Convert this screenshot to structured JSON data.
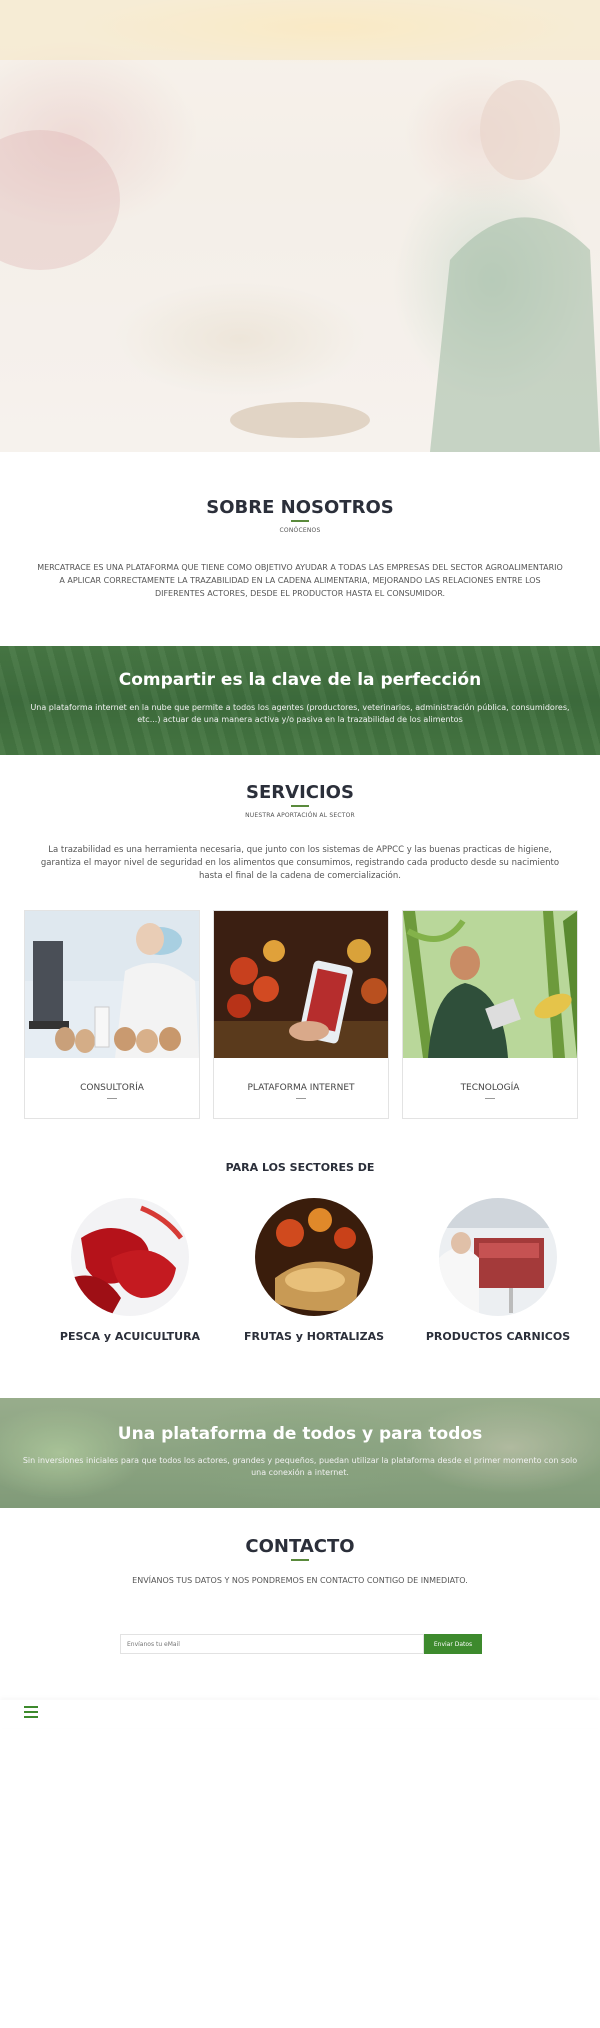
{
  "about": {
    "title": "SOBRE NOSOTROS",
    "subtitle": "CONÓCENOS",
    "text": "MERCATRACE ES UNA PLATAFORMA QUE TIENE COMO OBJETIVO AYUDAR A TODAS LAS EMPRESAS DEL SECTOR AGROALIMENTARIO A APLICAR CORRECTAMENTE LA TRAZABILIDAD EN LA CADENA ALIMENTARIA, MEJORANDO LAS RELACIONES ENTRE LOS DIFERENTES ACTORES, DESDE EL PRODUCTOR HASTA EL CONSUMIDOR."
  },
  "banner1": {
    "title": "Compartir es la clave de la perfección",
    "text": "Una plataforma internet en la nube que permite a todos los agentes (productores, veterinarios, administración pública, consumidores, etc...) actuar de una manera activa y/o pasiva en la trazabilidad de los alimentos"
  },
  "services": {
    "title": "SERVICIOS",
    "subtitle": "NUESTRA APORTACIÓN AL SECTOR",
    "text": "La trazabilidad es una herramienta necesaria, que junto con los sistemas de APPCC y las buenas practicas de higiene, garantiza el mayor nivel de seguridad en los alimentos que consumimos, registrando cada producto desde su nacimiento hasta el final de la cadena de comercialización.",
    "cards": [
      {
        "label": "CONSULTORÍA"
      },
      {
        "label": "PLATAFORMA INTERNET"
      },
      {
        "label": "TECNOLOGÍA"
      }
    ]
  },
  "sectors": {
    "title": "PARA LOS SECTORES DE",
    "items": [
      {
        "label": "PESCA y ACUICULTURA"
      },
      {
        "label": "FRUTAS y HORTALIZAS"
      },
      {
        "label": "PRODUCTOS CARNICOS"
      }
    ]
  },
  "banner2": {
    "title": "Una plataforma de todos y para todos",
    "text": "Sin inversiones iniciales para que todos los actores, grandes y pequeños, puedan utilizar la plataforma desde el primer momento con solo una conexión a internet."
  },
  "contact": {
    "title": "CONTACTO",
    "text": "ENVÍANOS TUS DATOS Y NOS PONDREMOS EN CONTACTO CONTIGO DE INMEDIATO.",
    "placeholder": "Envíanos tu eMail",
    "button": "Enviar Datos"
  },
  "colors": {
    "accent": "#3d8a2d",
    "heading": "#2b2f3a"
  }
}
